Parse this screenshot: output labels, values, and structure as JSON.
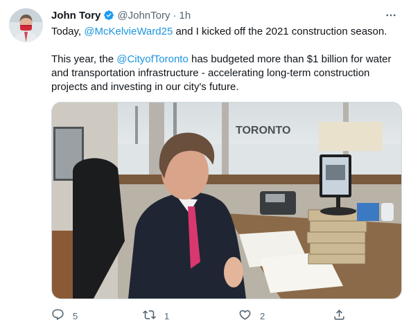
{
  "tweet": {
    "author_name": "John Tory",
    "handle": "@JohnTory",
    "separator": "·",
    "time": "1h",
    "line1_pre": "Today, ",
    "mention1": "@McKelvieWard25",
    "line1_post": " and I kicked off the 2021 construction season.",
    "line2_pre": "This year, the ",
    "mention2": "@CityofToronto",
    "line2_post": " has budgeted more than $1 billion for water and transportation infrastructure - accelerating long-term construction projects and investing in our city's future.",
    "photo_sign_text": "TORONTO"
  },
  "actions": {
    "reply_count": "5",
    "retweet_count": "1",
    "like_count": "2"
  },
  "icons": {
    "verified": "verified-badge-icon",
    "more": "more-horizontal-icon",
    "reply": "reply-icon",
    "retweet": "retweet-icon",
    "like": "heart-icon",
    "share": "share-icon"
  },
  "colors": {
    "accent": "#1d9bf0",
    "link": "#1b95e0",
    "muted": "#536471",
    "text": "#0f1419"
  }
}
